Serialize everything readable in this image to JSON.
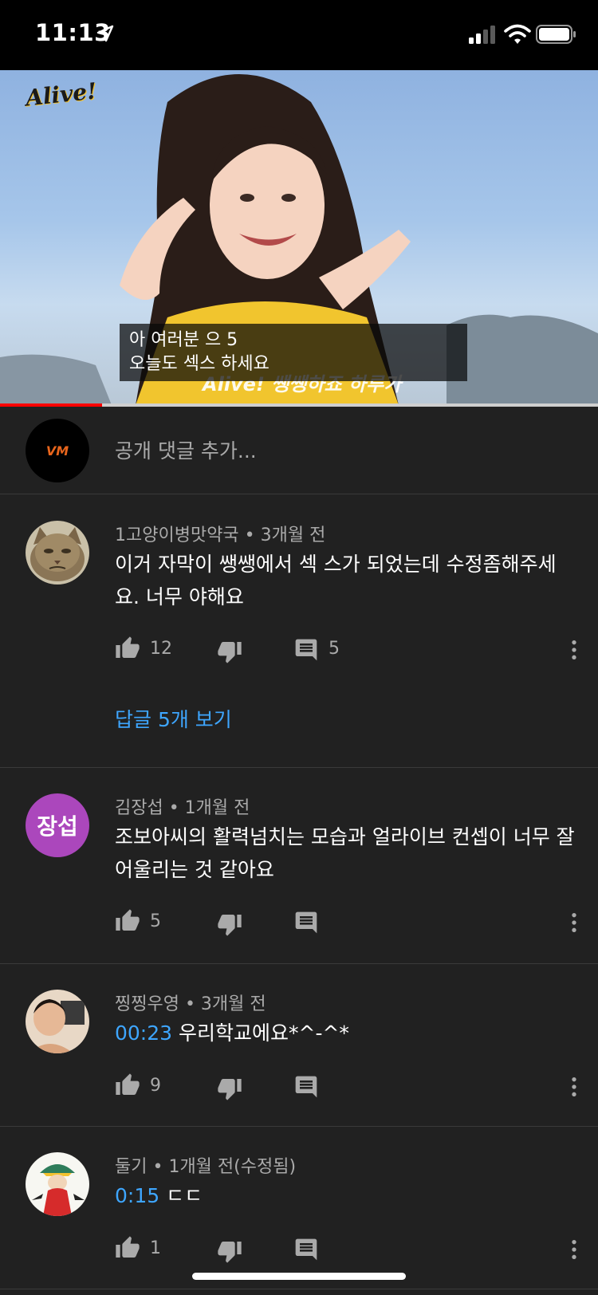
{
  "status_bar": {
    "time": "11:13"
  },
  "video": {
    "logo": "Alive!",
    "caption_line1": "아 여러분 으 5",
    "caption_line2": "오늘도 섹스 하세요",
    "burned_text": "Alive! 쌩쌩하죠 하루가",
    "progress": 0.17
  },
  "add_comment": {
    "placeholder": "공개 댓글 추가...",
    "avatar_text": "VM"
  },
  "comments": [
    {
      "author": "1고양이병맛약국",
      "time": "3개월 전",
      "meta": "1고양이병맛약국 • 3개월 전",
      "timestamp": "",
      "text": "이거 자막이 쌩쌩에서 섹 스가 되었는데 수정좀해주세요. 너무 야해요",
      "likes": "12",
      "replies": "5",
      "view_replies": "답글 5개 보기"
    },
    {
      "author": "김장섭",
      "meta": "김장섭 • 1개월 전",
      "avatar_text": "장섭",
      "timestamp": "",
      "text": "조보아씨의 활력넘치는 모습과 얼라이브 컨셉이 너무 잘 어울리는 것 같아요",
      "likes": "5"
    },
    {
      "author": "찡찡우영",
      "meta": "찡찡우영 • 3개월 전",
      "timestamp": "00:23",
      "text": " 우리학교에요*^-^*",
      "likes": "9"
    },
    {
      "author": "둘기",
      "meta": "둘기 • 1개월 전(수정됨)",
      "timestamp": "0:15",
      "text": " ㄷㄷ",
      "likes": "1"
    }
  ],
  "icons": {
    "location": "location-arrow-icon",
    "signal": "cellular-signal-icon",
    "wifi": "wifi-icon",
    "battery": "battery-icon",
    "like": "thumb-up-icon",
    "dislike": "thumb-down-icon",
    "reply": "reply-comment-icon",
    "more": "more-vertical-icon"
  },
  "colors": {
    "background": "#212121",
    "link": "#3ea6ff",
    "progress": "#ff0000",
    "letter_avatar": "#ab47bc"
  }
}
